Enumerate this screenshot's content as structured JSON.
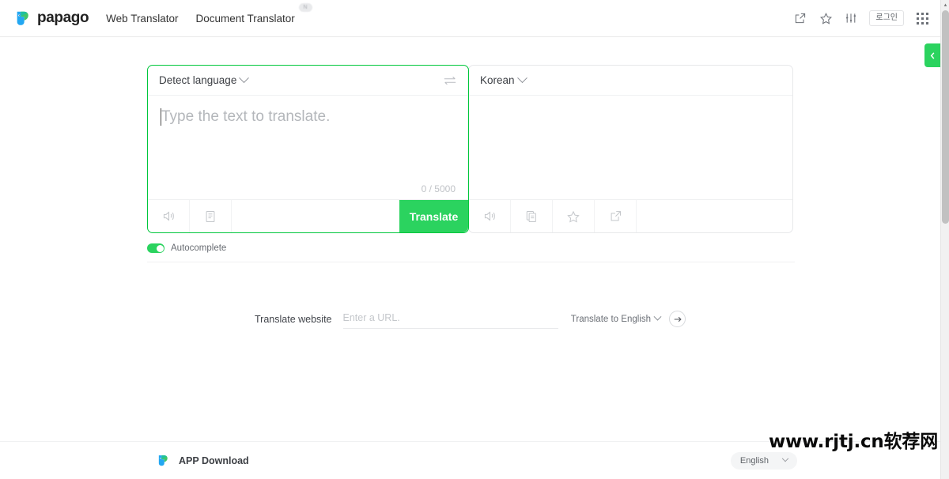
{
  "header": {
    "brand_name": "papago",
    "nav": [
      {
        "label": "Web Translator",
        "badge": ""
      },
      {
        "label": "Document Translator",
        "badge": "N"
      }
    ],
    "icons": [
      "external-link-icon",
      "star-icon",
      "sliders-icon",
      "apps-grid-icon"
    ],
    "login_label": "로그인"
  },
  "source_panel": {
    "language": "Detect language",
    "placeholder": "Type the text to translate.",
    "value": "",
    "counter": "0 / 5000",
    "tools": [
      "speaker-icon",
      "dictionary-icon"
    ],
    "translate_label": "Translate"
  },
  "target_panel": {
    "language": "Korean",
    "value": "",
    "tools": [
      "speaker-icon",
      "copy-icon",
      "star-icon",
      "share-icon"
    ]
  },
  "options": {
    "autocomplete_label": "Autocomplete",
    "autocomplete_on": true
  },
  "website_translate": {
    "label": "Translate website",
    "url_placeholder": "Enter a URL.",
    "url_value": "",
    "target_language": "Translate to English",
    "go_icon": "arrow-right-icon"
  },
  "footer": {
    "app_download_label": "APP Download",
    "language": "English"
  },
  "side_tab": {
    "icon": "chevron-left-icon"
  },
  "watermark": {
    "text": "www.rjtj.cn软荐网"
  },
  "colors": {
    "accent_green": "#2bd35f",
    "border_green": "#00c73c",
    "panel_border": "#e7e8ea",
    "text_primary": "#333333",
    "text_muted": "#b4b7bb"
  }
}
